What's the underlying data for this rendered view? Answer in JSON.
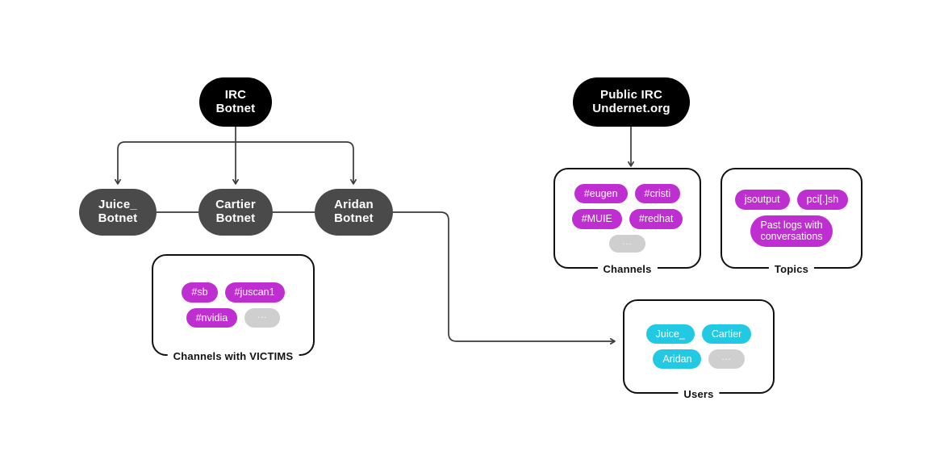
{
  "diagram": {
    "title": "IRC Botnet infrastructure diagram",
    "colors": {
      "root_node": "#000000",
      "botnet_node": "#4a4a4a",
      "chip_magenta": "#bf2ed0",
      "chip_cyan": "#22c9e2",
      "chip_grey": "#cfcfcf",
      "edge": "#3a3a3a",
      "card_border": "#111111",
      "background": "#ffffff"
    }
  },
  "nodes": {
    "irc_botnet": {
      "label": "IRC\nBotnet"
    },
    "public_irc": {
      "label": "Public IRC\nUndernet.org"
    },
    "juice_botnet": {
      "label": "Juice_\nBotnet"
    },
    "cartier_botnet": {
      "label": "Cartier\nBotnet"
    },
    "aridan_botnet": {
      "label": "Aridan\nBotnet"
    }
  },
  "cards": {
    "channels_with_victims": {
      "label": "Channels with VICTIMS",
      "chips": [
        {
          "text": "#sb",
          "color": "magenta"
        },
        {
          "text": "#juscan1",
          "color": "magenta"
        },
        {
          "text": "#nvidia",
          "color": "magenta"
        },
        {
          "text": "...",
          "color": "grey"
        }
      ]
    },
    "channels": {
      "label": "Channels",
      "chips": [
        {
          "text": "#eugen",
          "color": "magenta"
        },
        {
          "text": "#cristi",
          "color": "magenta"
        },
        {
          "text": "#MUIE",
          "color": "magenta"
        },
        {
          "text": "#redhat",
          "color": "magenta"
        },
        {
          "text": "...",
          "color": "grey"
        }
      ]
    },
    "topics": {
      "label": "Topics",
      "chips": [
        {
          "text": "jsoutput",
          "color": "magenta"
        },
        {
          "text": "pci[.]sh",
          "color": "magenta"
        },
        {
          "text": "Past logs with\nconversations",
          "color": "magenta"
        }
      ]
    },
    "users": {
      "label": "Users",
      "chips": [
        {
          "text": "Juice_",
          "color": "cyan"
        },
        {
          "text": "Cartier",
          "color": "cyan"
        },
        {
          "text": "Aridan",
          "color": "cyan"
        },
        {
          "text": "...",
          "color": "grey"
        }
      ]
    }
  },
  "edges": [
    {
      "name": "irc-botnet-to-juice-botnet",
      "arrow": true
    },
    {
      "name": "irc-botnet-to-cartier-botnet",
      "arrow": true
    },
    {
      "name": "irc-botnet-to-aridan-botnet",
      "arrow": true
    },
    {
      "name": "juice-botnet-to-cartier-botnet",
      "arrow": false
    },
    {
      "name": "cartier-botnet-to-aridan-botnet",
      "arrow": false
    },
    {
      "name": "public-irc-to-channels",
      "arrow": true
    },
    {
      "name": "aridan-botnet-to-users",
      "arrow": true
    }
  ]
}
